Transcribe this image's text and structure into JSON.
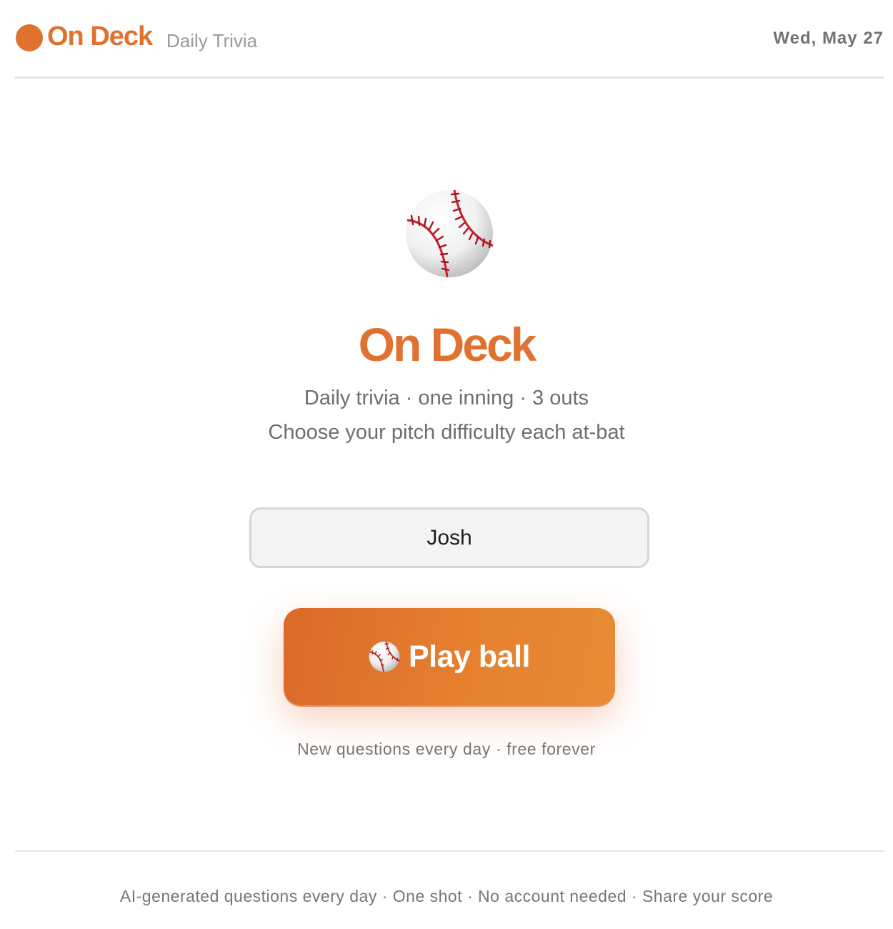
{
  "header": {
    "brand_name": "On Deck",
    "brand_subtitle": "Daily Trivia",
    "date": "Wed, May 27"
  },
  "hero": {
    "icon": "baseball-icon",
    "title": "On Deck",
    "tagline_line1": "Daily trivia · one inning · 3 outs",
    "tagline_line2": "Choose your pitch difficulty each at-bat"
  },
  "form": {
    "name_value": "Josh",
    "play_button_icon": "baseball-icon",
    "play_button_label": "Play ball",
    "subnote": "New questions every day · free forever"
  },
  "footer": {
    "text": "AI-generated questions every day · One shot · No account needed · Share your score"
  },
  "colors": {
    "accent": "#e07230",
    "seam": "#c8202a",
    "text_muted": "#6e6e6e"
  }
}
